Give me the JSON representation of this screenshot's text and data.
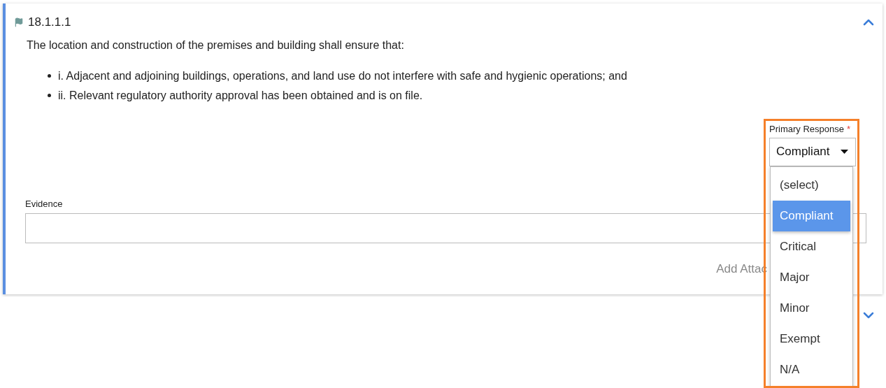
{
  "section": {
    "flagged": true,
    "number": "18.1.1.1",
    "expanded": true,
    "statement": "The location and construction of the premises and building shall ensure that:",
    "bullets": [
      "i. Adjacent and adjoining buildings, operations, and land use do not interfere with safe and hygienic operations; and",
      "ii. Relevant regulatory authority approval has been obtained and is on file."
    ],
    "primary_response": {
      "label": "Primary Response",
      "required_mark": "*",
      "value": "Compliant",
      "open": true,
      "options": [
        {
          "label": "(select)",
          "selected": false
        },
        {
          "label": "Compliant",
          "selected": true
        },
        {
          "label": "Critical",
          "selected": false
        },
        {
          "label": "Major",
          "selected": false
        },
        {
          "label": "Minor",
          "selected": false
        },
        {
          "label": "Exempt",
          "selected": false
        },
        {
          "label": "N/A",
          "selected": false
        }
      ]
    },
    "evidence": {
      "label": "Evidence"
    },
    "add_attachment": "Add Attac"
  },
  "next_section": {
    "expanded": false
  }
}
